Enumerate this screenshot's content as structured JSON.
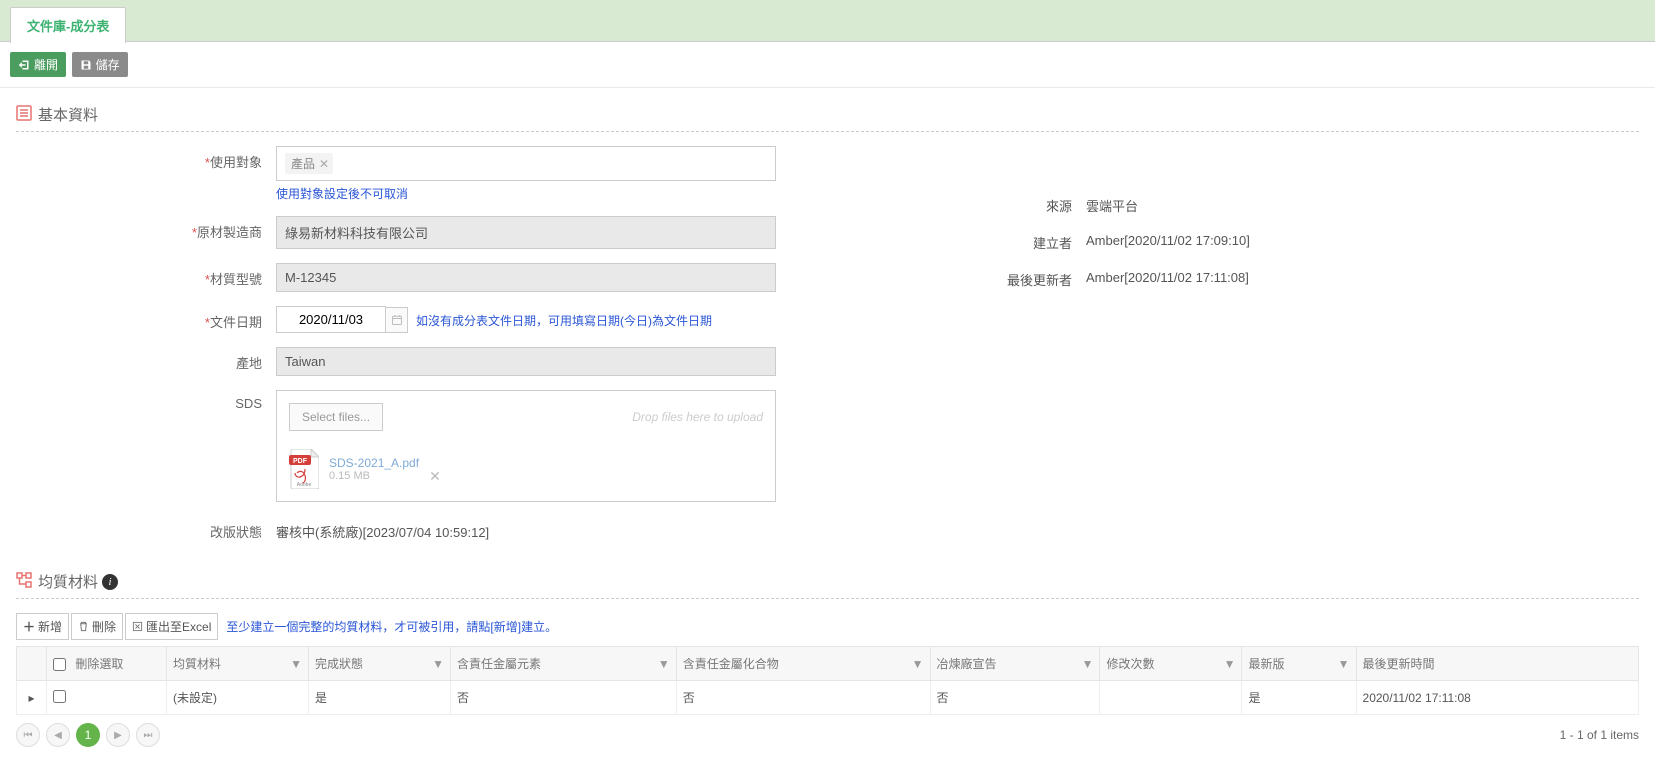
{
  "tab": {
    "label": "文件庫-成分表"
  },
  "toolbar": {
    "leave_label": "離開",
    "save_label": "儲存"
  },
  "section1_title": "基本資料",
  "section2_title": "均質材料",
  "form": {
    "usage": {
      "label": "使用對象",
      "chip": "產品",
      "hint": "使用對象設定後不可取消"
    },
    "manufacturer": {
      "label": "原材製造商",
      "value": "綠易新材料科技有限公司"
    },
    "material_no": {
      "label": "材質型號",
      "value": "M-12345"
    },
    "doc_date": {
      "label": "文件日期",
      "value": "2020/11/03",
      "hint": "如沒有成分表文件日期，可用填寫日期(今日)為文件日期"
    },
    "origin": {
      "label": "產地",
      "value": "Taiwan"
    },
    "sds": {
      "label": "SDS",
      "select_label": "Select files...",
      "drop_hint": "Drop files here to upload",
      "file_name": "SDS-2021_A.pdf",
      "file_size": "0.15 MB"
    },
    "rev_status": {
      "label": "改版狀態",
      "value": "審核中(系統廠)[2023/07/04 10:59:12]"
    }
  },
  "side": {
    "source": {
      "label": "來源",
      "value": "雲端平台"
    },
    "creator": {
      "label": "建立者",
      "value": "Amber[2020/11/02 17:09:10]"
    },
    "updater": {
      "label": "最後更新者",
      "value": "Amber[2020/11/02 17:11:08]"
    }
  },
  "grid_toolbar": {
    "add": "新增",
    "delete": "刪除",
    "export": "匯出至Excel",
    "hint": "至少建立一個完整的均質材料，才可被引用，請點[新增]建立。"
  },
  "grid": {
    "headers": {
      "del_sel": "刪除選取",
      "material": "均質材料",
      "complete": "完成狀態",
      "metal_elem": "含責任金屬元素",
      "metal_comp": "含責任金屬化合物",
      "smelter": "冶煉廠宣告",
      "rev_count": "修改次數",
      "latest": "最新版",
      "updated": "最後更新時間"
    },
    "row": {
      "material": "(未設定)",
      "complete": "是",
      "metal_elem": "否",
      "metal_comp": "否",
      "smelter": "否",
      "rev_count": "",
      "latest": "是",
      "updated": "2020/11/02 17:11:08"
    }
  },
  "pager": {
    "page": "1",
    "info": "1 - 1 of 1 items"
  }
}
